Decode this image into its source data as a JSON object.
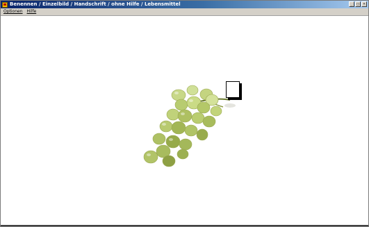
{
  "window": {
    "title": "Benennen / Einzelbild / Handschrift / ohne Hilfe / Lebensmittel",
    "buttons": [
      "_",
      "□",
      "×"
    ]
  },
  "menu": {
    "items": [
      "Optionen",
      "Hilfe"
    ]
  },
  "canvas": {
    "image": "grapes-icon",
    "card": "blank-card"
  }
}
